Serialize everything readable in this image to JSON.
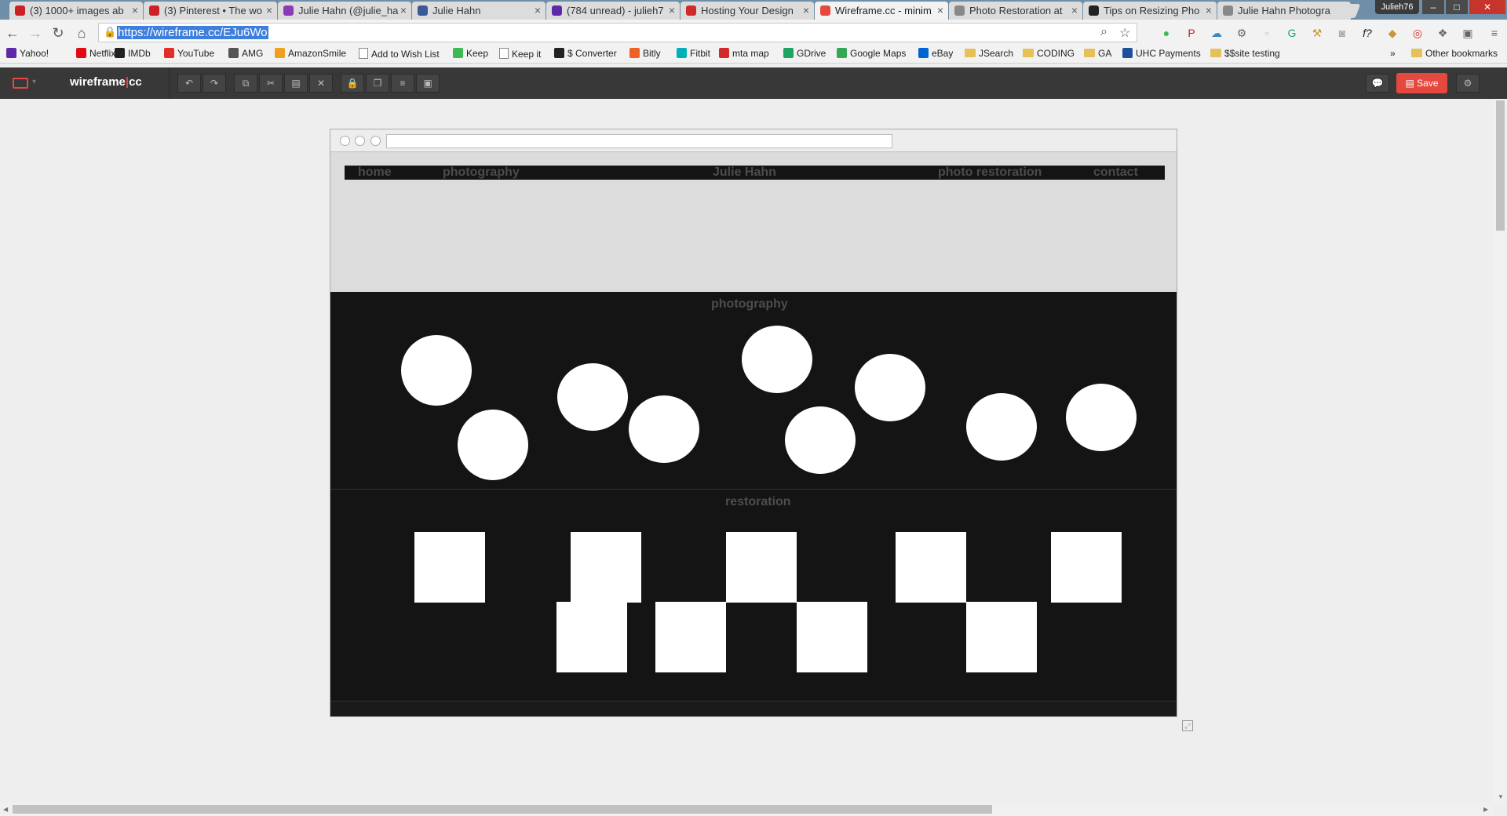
{
  "browser": {
    "tabs": [
      {
        "label": "(3) 1000+ images ab",
        "favicon": "pinterest-icon",
        "color": "#cb2027"
      },
      {
        "label": "(3) Pinterest • The wo",
        "favicon": "pinterest-icon",
        "color": "#cb2027"
      },
      {
        "label": "Julie Hahn (@julie_ha",
        "favicon": "instagram-icon",
        "color": "#8a3ab9"
      },
      {
        "label": "Julie Hahn",
        "favicon": "facebook-icon",
        "color": "#3b5998"
      },
      {
        "label": "(784 unread) - julieh7",
        "favicon": "yahoo-mail-icon",
        "color": "#5f2aa8"
      },
      {
        "label": "Hosting Your Design",
        "favicon": "hosting-icon",
        "color": "#d12a2a"
      },
      {
        "label": "Wireframe.cc - minim",
        "favicon": "wireframe-icon",
        "color": "#e5483e"
      },
      {
        "label": "Photo Restoration at",
        "favicon": "page-icon",
        "color": "#888888"
      },
      {
        "label": "Tips on Resizing Pho",
        "favicon": "page-icon-dark",
        "color": "#222222"
      },
      {
        "label": "Julie Hahn Photogra",
        "favicon": "page-icon",
        "color": "#888888"
      }
    ],
    "active_tab_index": 6,
    "profile": "Julieh76",
    "url": "https://wireframe.cc/EJu6Wo",
    "bookmarks": [
      {
        "label": "Yahoo!",
        "icon": "yahoo-icon",
        "color": "#5f2aa8"
      },
      {
        "label": "Netflix",
        "icon": "netflix-icon",
        "color": "#e50914"
      },
      {
        "label": "IMDb",
        "icon": "imdb-icon",
        "color": "#222222"
      },
      {
        "label": "YouTube",
        "icon": "youtube-icon",
        "color": "#e52d27"
      },
      {
        "label": "AMG",
        "icon": "amg-icon",
        "color": "#555555"
      },
      {
        "label": "AmazonSmile",
        "icon": "amazon-icon",
        "color": "#f0a020"
      },
      {
        "label": "Add to Wish List",
        "icon": "page-icon",
        "color": "#888888"
      },
      {
        "label": "Keep",
        "icon": "keep-icon",
        "color": "#3cba54"
      },
      {
        "label": "Keep it",
        "icon": "page-icon",
        "color": "#888888"
      },
      {
        "label": "$ Converter",
        "icon": "converter-icon",
        "color": "#222222"
      },
      {
        "label": "Bitly",
        "icon": "bitly-icon",
        "color": "#ee6123"
      },
      {
        "label": "Fitbit",
        "icon": "fitbit-icon",
        "color": "#00b0b9"
      },
      {
        "label": "mta map",
        "icon": "mta-icon",
        "color": "#d12a2a"
      },
      {
        "label": "GDrive",
        "icon": "gdrive-icon",
        "color": "#1fa463"
      },
      {
        "label": "Google Maps",
        "icon": "maps-icon",
        "color": "#34a853"
      },
      {
        "label": "eBay",
        "icon": "ebay-icon",
        "color": "#0064d2"
      },
      {
        "label": "JSearch",
        "icon": "folder-icon",
        "color": "#e6c15a"
      },
      {
        "label": "CODING",
        "icon": "folder-icon",
        "color": "#e6c15a"
      },
      {
        "label": "GA",
        "icon": "folder-icon",
        "color": "#e6c15a"
      },
      {
        "label": "UHC Payments",
        "icon": "uhc-icon",
        "color": "#1c4f9c"
      },
      {
        "label": "$$site testing",
        "icon": "folder-icon",
        "color": "#e6c15a"
      }
    ],
    "other_bookmarks": "Other bookmarks",
    "overflow": "»"
  },
  "app": {
    "brand_left": "wireframe",
    "brand_right": "cc",
    "save_label": "Save",
    "accent": "#e5483e",
    "toolbar_icons": [
      "undo-icon",
      "redo-icon",
      "copy-icon",
      "cut-icon",
      "paste-icon",
      "delete-icon",
      "lock-icon",
      "duplicate-icon",
      "align-icon",
      "group-icon"
    ],
    "toolbar_glyphs": [
      "↶",
      "↷",
      "⧉",
      "✂",
      "▤",
      "✕",
      "🔒",
      "❐",
      "≡",
      "▣"
    ]
  },
  "wireframe": {
    "nav": {
      "home": "home",
      "photography": "photography",
      "title": "Julie Hahn",
      "restoration": "photo restoration",
      "contact": "contact"
    },
    "sections": {
      "photography_title": "photography",
      "restoration_title": "restoration"
    },
    "photography_circle_count": 9,
    "restoration_square_count": 9
  }
}
